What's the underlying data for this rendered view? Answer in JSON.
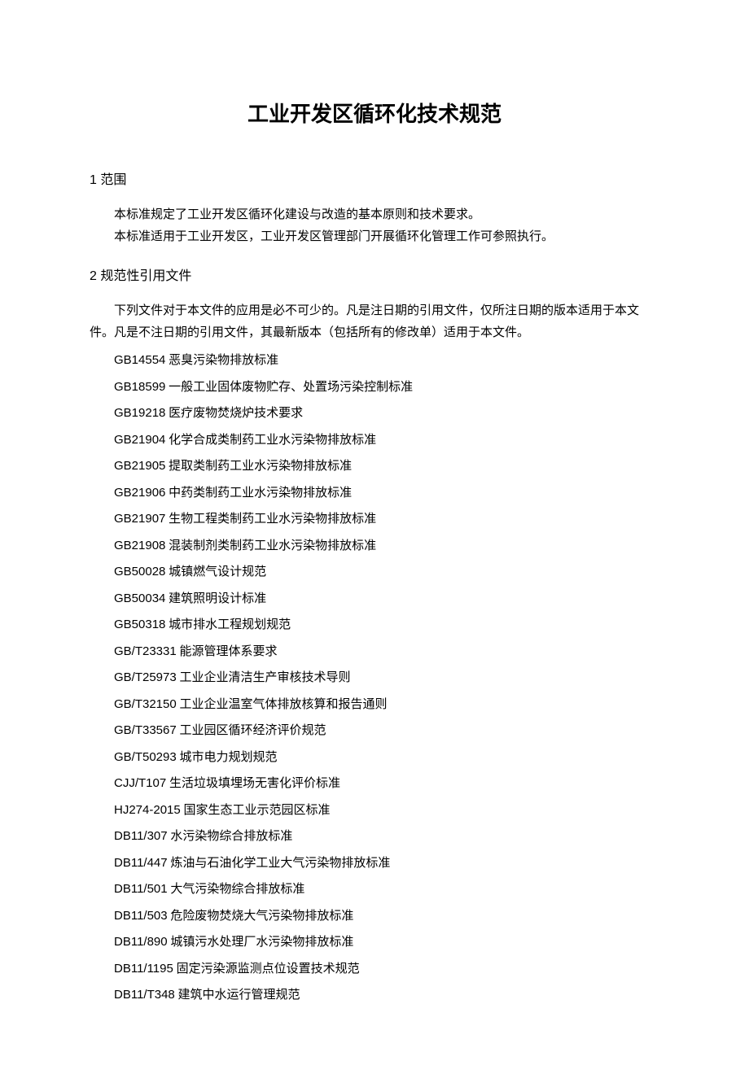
{
  "title": "工业开发区循环化技术规范",
  "sections": {
    "scope": {
      "heading": "1 范围",
      "paragraphs": [
        "本标准规定了工业开发区循环化建设与改造的基本原则和技术要求。",
        "本标准适用于工业开发区，工业开发区管理部门开展循环化管理工作可参照执行。"
      ]
    },
    "references": {
      "heading": "2 规范性引用文件",
      "intro": "下列文件对于本文件的应用是必不可少的。凡是注日期的引用文件，仅所注日期的版本适用于本文件。凡是不注日期的引用文件，其最新版本（包括所有的修改单）适用于本文件。",
      "items": [
        {
          "code": "GB14554",
          "title": " 恶臭污染物排放标准"
        },
        {
          "code": "GB18599",
          "title": " 一般工业固体废物贮存、处置场污染控制标准"
        },
        {
          "code": "GB19218",
          "title": " 医疗废物焚烧炉技术要求"
        },
        {
          "code": "GB21904",
          "title": " 化学合成类制药工业水污染物排放标准"
        },
        {
          "code": "GB21905",
          "title": " 提取类制药工业水污染物排放标准"
        },
        {
          "code": "GB21906",
          "title": " 中药类制药工业水污染物排放标准"
        },
        {
          "code": "GB21907",
          "title": " 生物工程类制药工业水污染物排放标准"
        },
        {
          "code": "GB21908",
          "title": " 混装制剂类制药工业水污染物排放标准"
        },
        {
          "code": "GB50028",
          "title": " 城镇燃气设计规范"
        },
        {
          "code": "GB50034",
          "title": " 建筑照明设计标准"
        },
        {
          "code": "GB50318",
          "title": " 城市排水工程规划规范"
        },
        {
          "code": "GB/T23331",
          "title": " 能源管理体系要求"
        },
        {
          "code": "GB/T25973",
          "title": " 工业企业清洁生产审核技术导则"
        },
        {
          "code": "GB/T32150",
          "title": " 工业企业温室气体排放核算和报告通则"
        },
        {
          "code": "GB/T33567",
          "title": " 工业园区循环经济评价规范"
        },
        {
          "code": "GB/T50293",
          "title": " 城市电力规划规范"
        },
        {
          "code": "CJJ/T107",
          "title": " 生活垃圾填埋场无害化评价标准"
        },
        {
          "code": "HJ274-2015",
          "title": " 国家生态工业示范园区标准"
        },
        {
          "code": "DB11/307",
          "title": " 水污染物综合排放标准"
        },
        {
          "code": "DB11/447",
          "title": " 炼油与石油化学工业大气污染物排放标准"
        },
        {
          "code": "DB11/501",
          "title": " 大气污染物综合排放标准"
        },
        {
          "code": "DB11/503",
          "title": " 危险废物焚烧大气污染物排放标准"
        },
        {
          "code": "DB11/890",
          "title": " 城镇污水处理厂水污染物排放标准"
        },
        {
          "code": "DB11/1195",
          "title": " 固定污染源监测点位设置技术规范"
        },
        {
          "code": "DB11/T348",
          "title": " 建筑中水运行管理规范"
        }
      ]
    }
  }
}
